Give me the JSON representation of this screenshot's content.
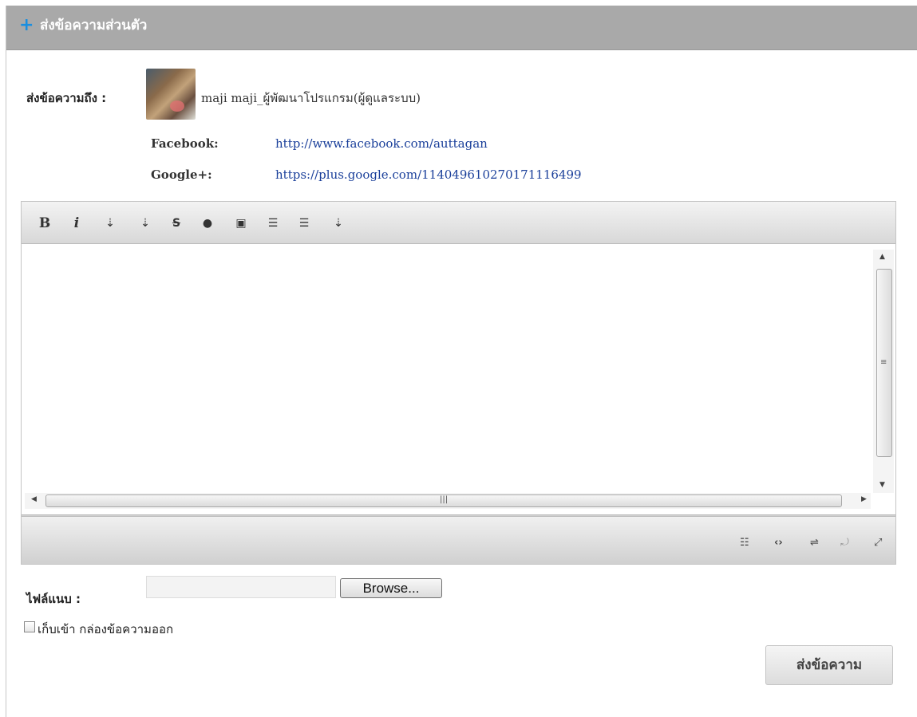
{
  "header": {
    "icon": "plus-icon",
    "title": "ส่งข้อความส่วนตัว"
  },
  "recipient": {
    "label": "ส่งข้อความถึง :",
    "name": "maji maji_ผู้พัฒนาโปรแกรม(ผู้ดูแลระบบ)",
    "facebook_key": "Facebook:",
    "facebook_url": "http://www.facebook.com/auttagan",
    "google_key": "Google+:",
    "google_url": "https://plus.google.com/114049610270171116499"
  },
  "toolbar": {
    "bold": "B",
    "italic": "i",
    "underline": "⇣",
    "insert": "⇣",
    "strike": "S",
    "clock": "●",
    "image": "▣",
    "ordered_list": "☰",
    "unordered_list": "☰",
    "more": "⇣"
  },
  "editor": {
    "content": ""
  },
  "bottombar": {
    "b1": "☷",
    "b2": "‹›",
    "b3": "⇌",
    "b4": "⤾",
    "b5": "⤢"
  },
  "attachment": {
    "label": "ไฟล์แนบ :",
    "value": "",
    "browse_label": "Browse..."
  },
  "save_outbox": {
    "checked": false,
    "label": "เก็บเข้า กล่องข้อความออก"
  },
  "send_button": "ส่งข้อความ"
}
